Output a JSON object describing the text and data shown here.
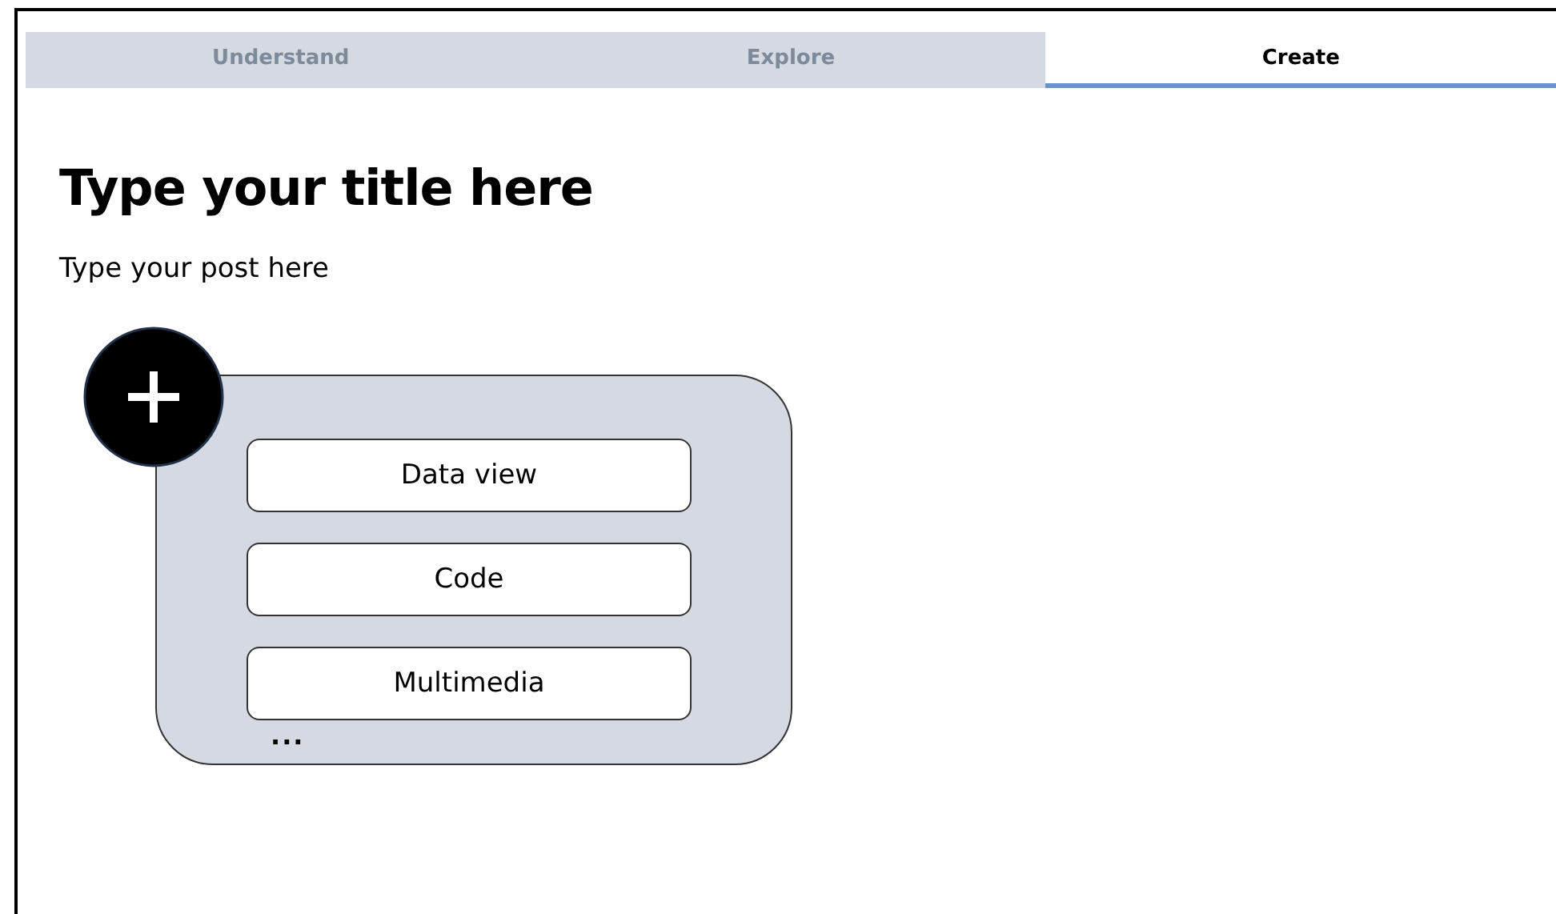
{
  "tabs": [
    {
      "label": "Understand",
      "selected": false
    },
    {
      "label": "Explore",
      "selected": false
    },
    {
      "label": "Create",
      "selected": true
    }
  ],
  "post": {
    "title": "Type your title here",
    "body": "Type your post here"
  },
  "insert_menu": {
    "options": [
      {
        "label": "Data view"
      },
      {
        "label": "Code"
      },
      {
        "label": "Multimedia"
      }
    ],
    "more": "..."
  }
}
